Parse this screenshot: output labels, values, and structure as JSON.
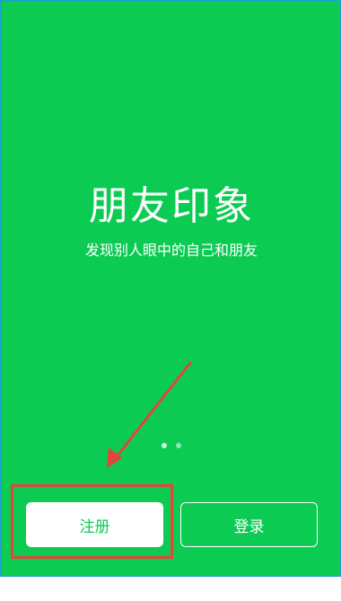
{
  "app": {
    "title": "朋友印象",
    "subtitle": "发现别人眼中的自己和朋友"
  },
  "pager": {
    "current_page": 1,
    "total_pages": 2
  },
  "buttons": {
    "register_label": "注册",
    "login_label": "登录"
  },
  "colors": {
    "background": "#0ccb53",
    "annotation": "#e2453a",
    "text": "#ffffff"
  }
}
